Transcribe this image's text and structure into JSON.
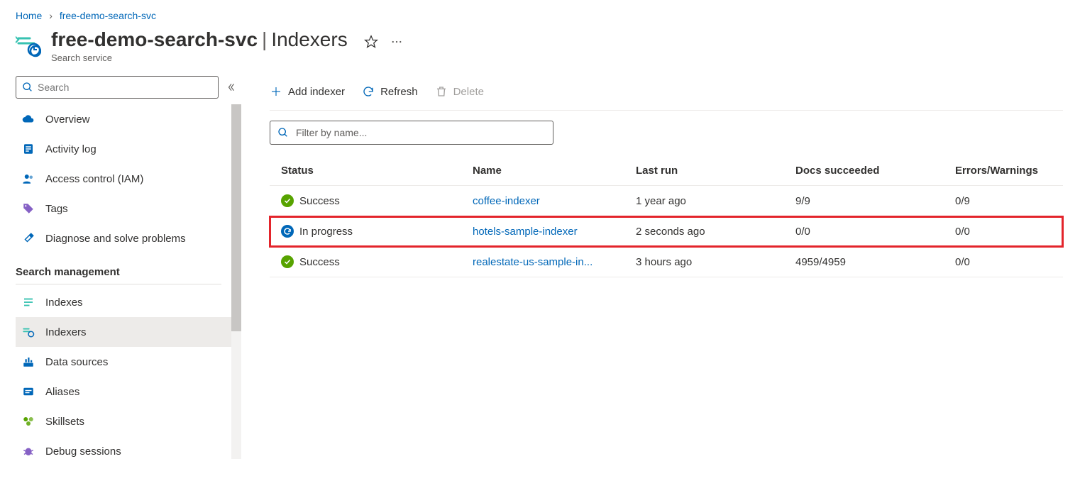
{
  "breadcrumb": {
    "home": "Home",
    "current": "free-demo-search-svc"
  },
  "header": {
    "title": "free-demo-search-svc",
    "section": "Indexers",
    "subtitle": "Search service"
  },
  "sidebar": {
    "search_placeholder": "Search",
    "items": [
      {
        "label": "Overview"
      },
      {
        "label": "Activity log"
      },
      {
        "label": "Access control (IAM)"
      },
      {
        "label": "Tags"
      },
      {
        "label": "Diagnose and solve problems"
      }
    ],
    "section_label": "Search management",
    "mgmt_items": [
      {
        "label": "Indexes"
      },
      {
        "label": "Indexers"
      },
      {
        "label": "Data sources"
      },
      {
        "label": "Aliases"
      },
      {
        "label": "Skillsets"
      },
      {
        "label": "Debug sessions"
      }
    ]
  },
  "toolbar": {
    "add": "Add indexer",
    "refresh": "Refresh",
    "delete": "Delete"
  },
  "filter": {
    "placeholder": "Filter by name..."
  },
  "table": {
    "headers": {
      "status": "Status",
      "name": "Name",
      "last_run": "Last run",
      "docs": "Docs succeeded",
      "errors": "Errors/Warnings"
    },
    "rows": [
      {
        "status": "Success",
        "status_type": "success",
        "name": "coffee-indexer",
        "last_run": "1 year ago",
        "docs": "9/9",
        "errors": "0/9",
        "highlight": false
      },
      {
        "status": "In progress",
        "status_type": "inprogress",
        "name": "hotels-sample-indexer",
        "last_run": "2 seconds ago",
        "docs": "0/0",
        "errors": "0/0",
        "highlight": true
      },
      {
        "status": "Success",
        "status_type": "success",
        "name": "realestate-us-sample-in...",
        "last_run": "3 hours ago",
        "docs": "4959/4959",
        "errors": "0/0",
        "highlight": false
      }
    ]
  }
}
